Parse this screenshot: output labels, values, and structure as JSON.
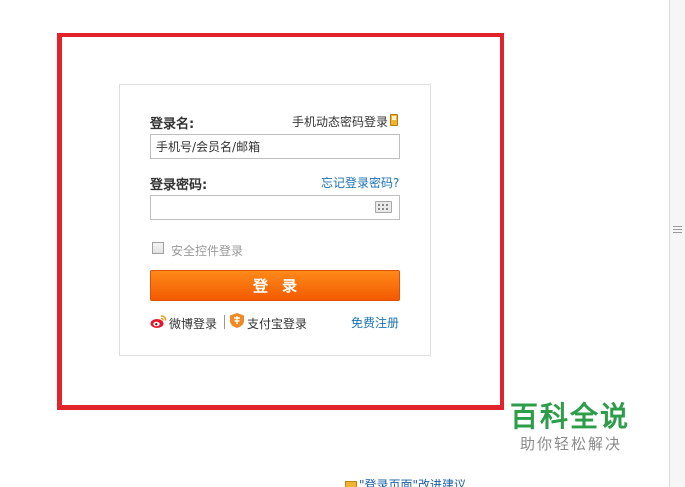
{
  "login": {
    "username_label": "登录名:",
    "sms_login_link": "手机动态密码登录",
    "username_placeholder": "手机号/会员名/邮箱",
    "password_label": "登录密码:",
    "forgot_password_link": "忘记登录密码?",
    "password_value": "",
    "security_control_label": "安全控件登录",
    "security_control_checked": false,
    "submit_label": "登录",
    "weibo_login": "微博登录",
    "alipay_login": "支付宝登录",
    "register_link": "免费注册"
  },
  "feedback": {
    "text": "\"登录页面\"改进建议"
  },
  "watermark": {
    "title": "百科全说",
    "subtitle": "助你轻松解决"
  },
  "colors": {
    "highlight_frame": "#e2232b",
    "button": "#f25a00",
    "link": "#1a73b5",
    "watermark": "#2e9d4a"
  }
}
